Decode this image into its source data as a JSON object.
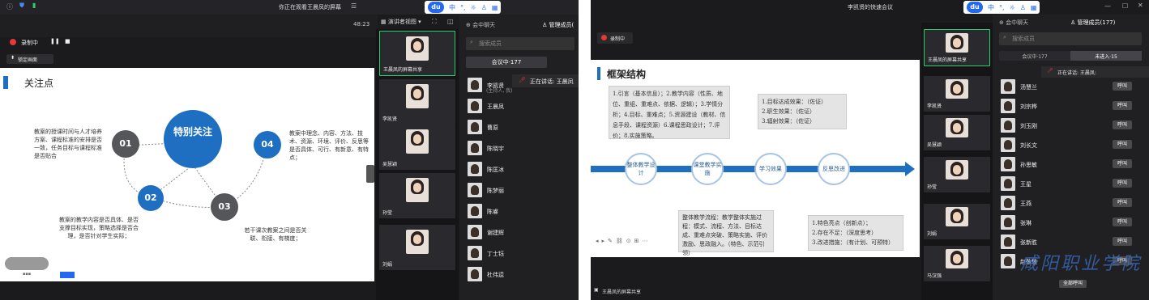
{
  "left_window": {
    "title": "你正在观看王晨凤的屏幕",
    "timer": "48:23",
    "recording_label": "录制中",
    "lock_label": "锁定画面",
    "view_label": "演讲者视图",
    "chat_tab": "会中聊天",
    "members_tab": "管理成员(",
    "search_placeholder": "搜索成员",
    "in_meeting_tab": "会议中·177",
    "speaking": "正在讲话: 王晨凤",
    "host_note": "(主持人, 我)",
    "tiles": [
      "王晨凤的屏幕共享",
      "李凯贤",
      "吴慧颖",
      "孙莹",
      "刘娟"
    ],
    "members": [
      "李凯贤",
      "王晨凤",
      "曹原",
      "陈晓宇",
      "陈匡冰",
      "陈梦丽",
      "陈睿",
      "谢建辉",
      "丁士钰",
      "杜伟逵"
    ],
    "slide": {
      "title": "关注点",
      "center": "特别关注",
      "n1": "01",
      "n2": "02",
      "n3": "03",
      "n4": "04",
      "t1": "教案的授课时间与人才培养方案、课程标准的安排是否一致，任务目标与课程标准是否贴合",
      "t2": "教案的教学内容是否具体、是否支撑目标实现，策略选择是否合理，是否针对学生实际；",
      "t3": "若干课次教案之间是否关联、衔接、有梯度；",
      "t4": "教案中理念、内容、方法、技术、资源、环境、评价、反思等是否具体、可行、有新意、有特点；"
    }
  },
  "right_window": {
    "title": "李凯贤的快速会议",
    "recording_label": "录制中",
    "chat_tab": "会中聊天",
    "members_tab": "管理成员(177)",
    "search_placeholder": "搜索成员",
    "tab_in": "会议中·177",
    "tab_out": "未进入·15",
    "speaking": "正在讲话: 王晨凤:",
    "share_label": "王晨凤的屏幕共享",
    "invite_label": "全部呼叫",
    "call_label": "呼叫",
    "tiles": [
      "王晨凤的屏幕共享",
      "李凯贤",
      "吴慧颖",
      "孙莹",
      "刘娟",
      "马汉强"
    ],
    "members": [
      "汤慧兰",
      "刘宗桦",
      "刘玉刚",
      "刘长文",
      "孙思敏",
      "王星",
      "王燕",
      "张琳",
      "张新胜",
      "赵敬敬"
    ],
    "watermark": "咸阳职业学院",
    "slide": {
      "title": "框架结构",
      "box1": "1.引言（基本信息）；2.教学内容（性质、地位、重组、重难点、依据、逻辑）；3.学情分析；4.目标、重难点；5.资源建设（教材、信息手段、课程资源）6.课程思政设计；7.评价；8.实施策略。",
      "box2": "1.目标达成效果：（佐证）\n2.职生效果：（佐证）\n3.辐射效果：（佐证）",
      "box3": "整体教学流程：教学整体实施过程：模式、流程、方法、目标达成、重难点突破、策略实施、评价激励、思政融入。（特色、示范引领）",
      "box4": "1.特色亮点（创新点）；\n2.存在不足：（深度思考）\n3.改进措施：（有计划、可预特）",
      "node1": "整体教学设计",
      "node2": "课堂教学实施",
      "node3": "学习效果",
      "node4": "反思改进"
    }
  },
  "colors": {
    "accent": "#1e6fc2",
    "dark": "#55565a",
    "record": "#e53935",
    "green": "#2ecc71"
  }
}
